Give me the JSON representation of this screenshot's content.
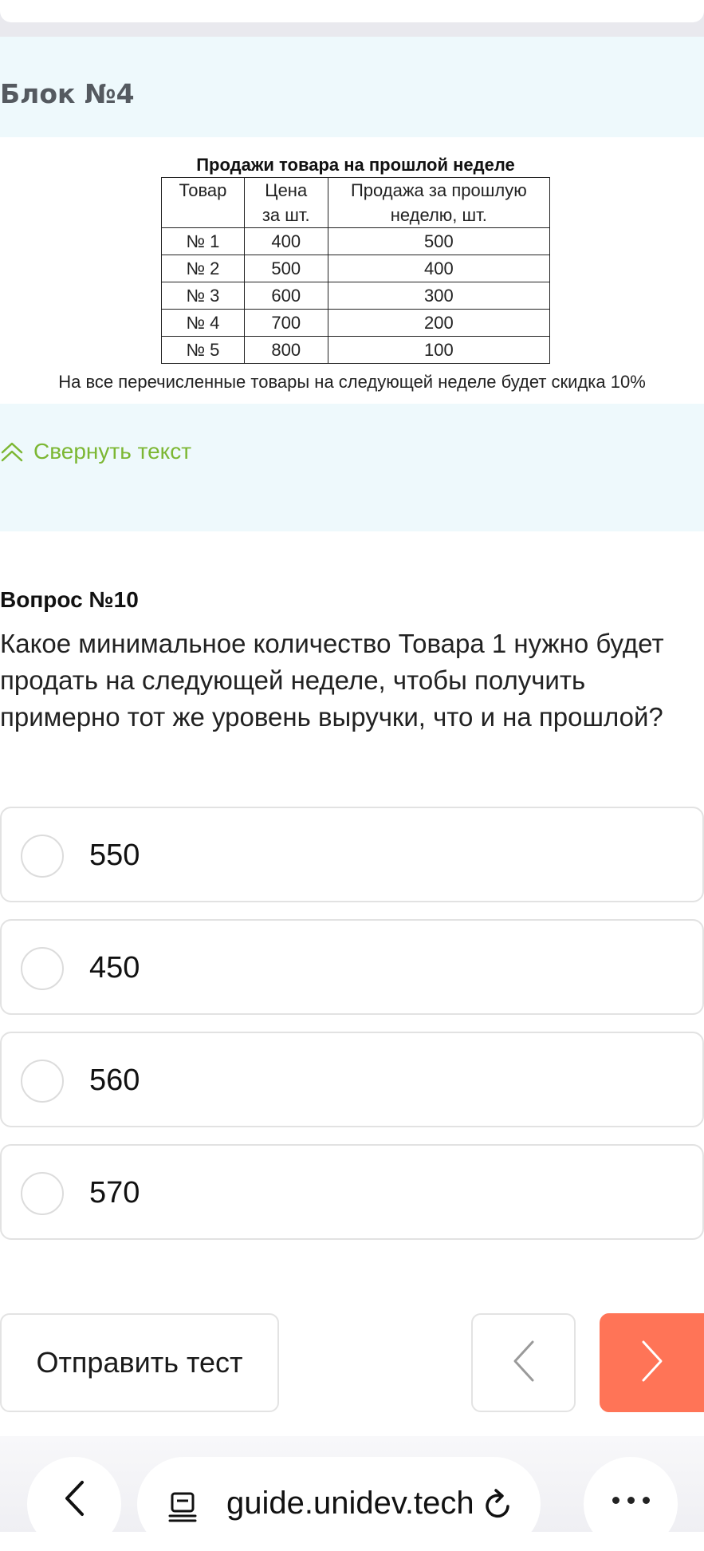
{
  "block": {
    "title": "Блок №4"
  },
  "sales_table": {
    "caption": "Продажи товара на прошлой неделе",
    "headers": [
      "Товар",
      "Цена\nза шт.",
      "Продажа за прошлую\nнеделю, шт."
    ],
    "rows": [
      [
        "№ 1",
        "400",
        "500"
      ],
      [
        "№ 2",
        "500",
        "400"
      ],
      [
        "№ 3",
        "600",
        "300"
      ],
      [
        "№ 4",
        "700",
        "200"
      ],
      [
        "№ 5",
        "800",
        "100"
      ]
    ],
    "note": "На все перечисленные товары на следующей неделе будет скидка 10%"
  },
  "collapse": {
    "label": "Свернуть текст",
    "icon": "double-chevron-up-icon",
    "color": "#7cb733"
  },
  "question": {
    "label": "Вопрос №10",
    "text": "Какое минимальное количество Товара 1 нужно будет продать на следующей неделе, чтобы получить примерно тот же уровень выручки, что и на прошлой?",
    "options": [
      "550",
      "450",
      "560",
      "570"
    ]
  },
  "actions": {
    "submit_label": "Отправить тест",
    "prev_icon": "chevron-left-icon",
    "next_icon": "chevron-right-icon",
    "next_color": "#ff7457"
  },
  "browser": {
    "url": "guide.unidev.tech",
    "back_icon": "chevron-left-icon",
    "page_icon": "page-settings-icon",
    "reload_icon": "reload-icon",
    "more_icon": "more-dots-icon"
  }
}
